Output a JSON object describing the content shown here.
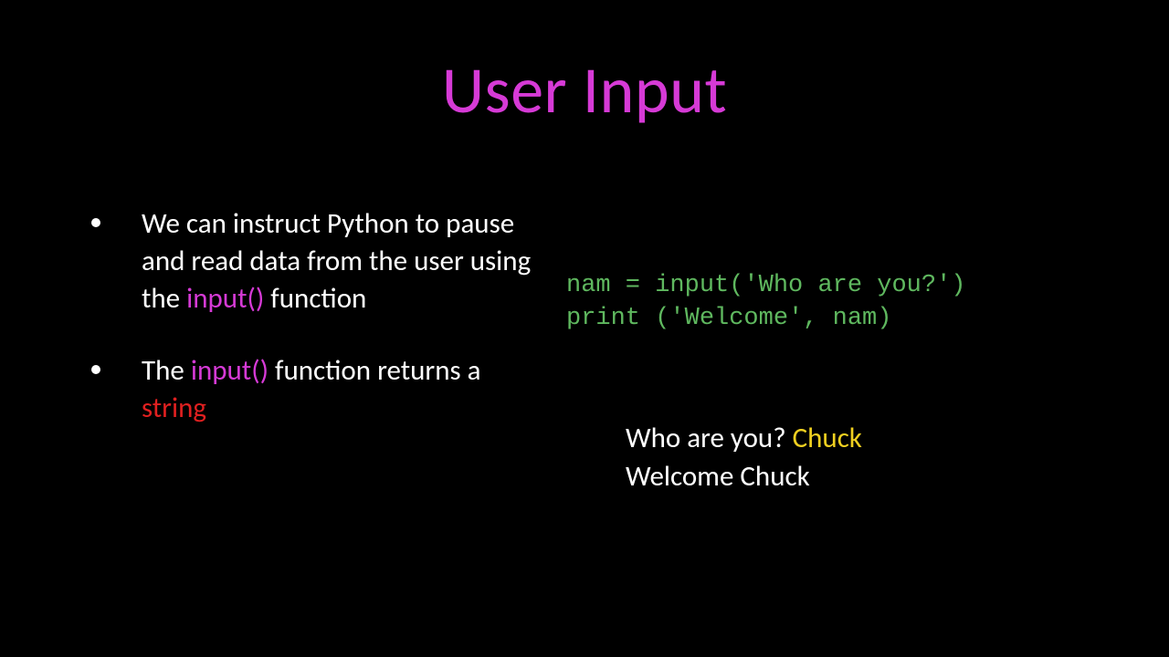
{
  "title": "User Input",
  "bullets": [
    {
      "pre": "We can instruct Python to pause and read data from the user using the ",
      "hl": "input()",
      "hlClass": "hl-magenta",
      "post": "  function"
    },
    {
      "pre": "The ",
      "hl": "input()",
      "hlClass": "hl-magenta",
      "mid": "  function returns a ",
      "hl2": "string",
      "hl2Class": "hl-red"
    }
  ],
  "code": {
    "line1": "nam = input('Who are you?')",
    "line2": "print ('Welcome', nam)"
  },
  "output": {
    "line1_pre": "Who are you? ",
    "line1_hl": "Chuck",
    "line2": "Welcome Chuck"
  }
}
